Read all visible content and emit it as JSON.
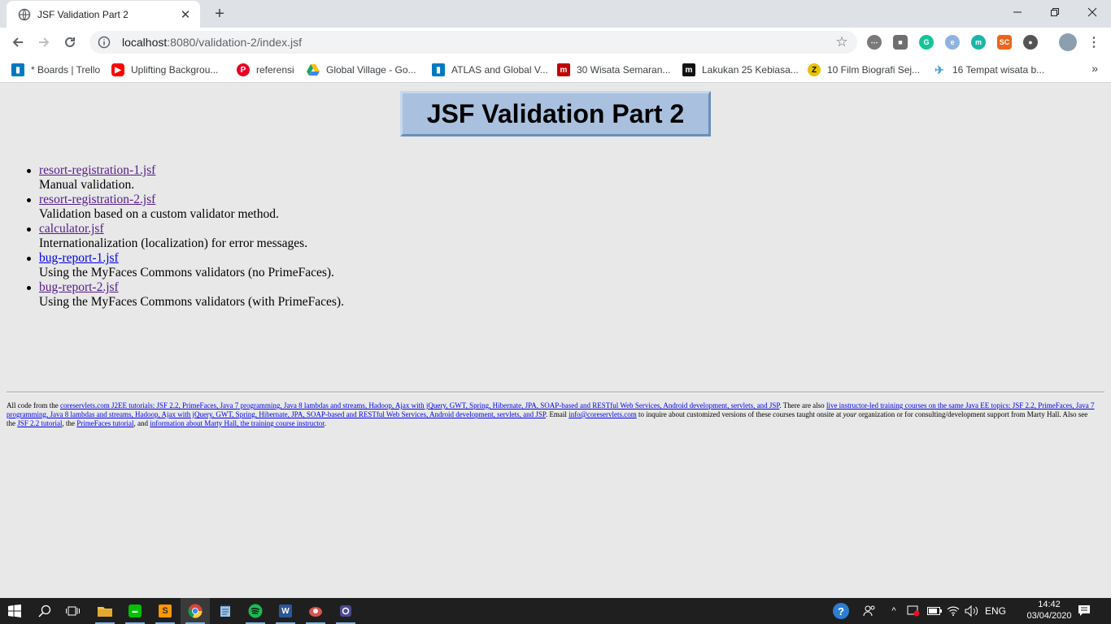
{
  "browser": {
    "tab_title": "JSF Validation Part 2",
    "url_host": "localhost",
    "url_rest": ":8080/validation-2/index.jsf"
  },
  "bookmarks": [
    {
      "label": "* Boards | Trello",
      "icon": "trello-icon",
      "color": "#0079bf"
    },
    {
      "label": "Uplifting Backgrou...",
      "icon": "youtube-icon",
      "color": "#ff0000"
    },
    {
      "label": "referensi",
      "icon": "pinterest-icon",
      "color": "#e60023"
    },
    {
      "label": "Global Village - Go...",
      "icon": "google-drive-icon",
      "color": "#1fa463"
    },
    {
      "label": "ATLAS and Global V...",
      "icon": "trello-icon",
      "color": "#0079bf"
    },
    {
      "label": "30 Wisata Semaran...",
      "icon": "m-logo-icon",
      "color": "#c00000"
    },
    {
      "label": "Lakukan 25 Kebiasa...",
      "icon": "medium-icon",
      "color": "#111111"
    },
    {
      "label": "10 Film Biografi Sej...",
      "icon": "z-logo-icon",
      "color": "#e6c200"
    },
    {
      "label": "16 Tempat wisata b...",
      "icon": "bird-icon",
      "color": "#4aa3df"
    }
  ],
  "page": {
    "heading": "JSF Validation Part 2",
    "items": [
      {
        "link": "resort-registration-1.jsf",
        "desc": "Manual validation."
      },
      {
        "link": "resort-registration-2.jsf",
        "desc": "Validation based on a custom validator method."
      },
      {
        "link": "calculator.jsf",
        "desc": "Internationalization (localization) for error messages."
      },
      {
        "link": "bug-report-1.jsf",
        "desc": "Using the MyFaces Commons validators (no PrimeFaces)."
      },
      {
        "link": "bug-report-2.jsf",
        "desc": "Using the MyFaces Commons validators (with PrimeFaces)."
      }
    ],
    "footer": {
      "t1": "All code from the ",
      "l1": "coreservlets.com J2EE tutorials: JSF 2.2, PrimeFaces, Java 7 programming, Java 8 lambdas and streams, Hadoop, Ajax with jQuery, GWT, Spring, Hibernate, JPA, SOAP-based and RESTful Web Services, Android development, servlets, and JSP",
      "t2": ". There are also ",
      "l2": "live instructor-led training courses on the same Java EE topics: JSF 2.2, PrimeFaces, Java 7 programming, Java 8 lambdas and streams, Hadoop, Ajax with jQuery, GWT, Spring, Hibernate, JPA, SOAP-based and RESTful Web Services, Android development, servlets, and JSP",
      "t3": ". Email ",
      "l3": "info@coreservlets.com",
      "t4": " to inquire about customized versions of these courses taught onsite at ",
      "t4i": "your",
      "t5": " organization or for consulting/development support from Marty Hall. Also see the ",
      "l4": "JSF 2.2 tutorial",
      "t6": ", the ",
      "l5": "PrimeFaces tutorial",
      "t7": ", and ",
      "l6": "information about Marty Hall, the training course instructor",
      "t8": "."
    }
  },
  "taskbar": {
    "language": "ENG",
    "time": "14:42",
    "date": "03/04/2020"
  }
}
